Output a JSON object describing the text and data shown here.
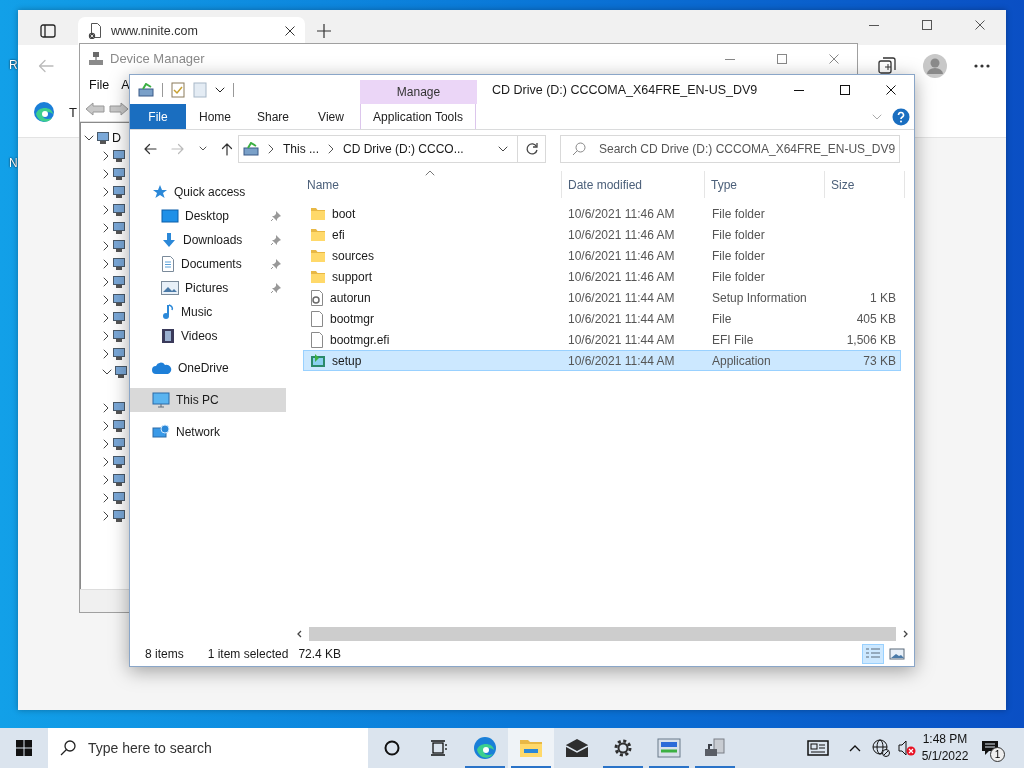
{
  "desktop": {
    "icon_labels": [
      "R",
      "N"
    ]
  },
  "browser": {
    "tab_title": "www.ninite.com",
    "toolbar_text": "T"
  },
  "device_manager": {
    "title": "Device Manager",
    "menu": [
      "File",
      "A"
    ],
    "tree": [
      {
        "label": "D",
        "expanded": true,
        "children": [
          {
            "expanded": false
          },
          {
            "expanded": false
          },
          {
            "expanded": false
          },
          {
            "expanded": false
          },
          {
            "expanded": false
          },
          {
            "expanded": false
          },
          {
            "expanded": false
          },
          {
            "expanded": false
          },
          {
            "expanded": false
          },
          {
            "expanded": false
          },
          {
            "expanded": false
          },
          {
            "expanded": false
          },
          {
            "expanded": true
          },
          {
            "expanded": false
          },
          {
            "expanded": false
          },
          {
            "expanded": false
          },
          {
            "expanded": false
          },
          {
            "expanded": false
          },
          {
            "expanded": false
          },
          {
            "expanded": false
          }
        ]
      }
    ]
  },
  "explorer": {
    "title": "CD Drive (D:) CCCOMA_X64FRE_EN-US_DV9",
    "ribbon": {
      "context_header": "Manage",
      "tabs": [
        {
          "label": "File",
          "kind": "file",
          "selected": true
        },
        {
          "label": "Home",
          "kind": "plain",
          "selected": false
        },
        {
          "label": "Share",
          "kind": "plain",
          "selected": false
        },
        {
          "label": "View",
          "kind": "plain",
          "selected": false
        },
        {
          "label": "Application Tools",
          "kind": "context",
          "selected": false
        }
      ]
    },
    "address": {
      "crumbs": [
        "This ...",
        "CD Drive (D:) CCCO..."
      ]
    },
    "search": {
      "placeholder": "Search CD Drive (D:) CCCOMA_X64FRE_EN-US_DV9"
    },
    "nav": [
      {
        "label": "Quick access",
        "kind": "quick",
        "selected": false,
        "children": [
          {
            "label": "Desktop",
            "kind": "desktop",
            "pinned": true,
            "selected": false
          },
          {
            "label": "Downloads",
            "kind": "downloads",
            "pinned": true,
            "selected": false
          },
          {
            "label": "Documents",
            "kind": "documents",
            "pinned": true,
            "selected": false
          },
          {
            "label": "Pictures",
            "kind": "pictures",
            "pinned": true,
            "selected": false
          },
          {
            "label": "Music",
            "kind": "music",
            "pinned": false,
            "selected": false
          },
          {
            "label": "Videos",
            "kind": "videos",
            "pinned": false,
            "selected": false
          }
        ]
      },
      {
        "label": "OneDrive",
        "kind": "cloud",
        "selected": false
      },
      {
        "label": "This PC",
        "kind": "pc",
        "selected": true
      },
      {
        "label": "Network",
        "kind": "network",
        "selected": false
      }
    ],
    "columns": [
      {
        "label": "Name",
        "sorted": true
      },
      {
        "label": "Date modified",
        "sorted": false
      },
      {
        "label": "Type",
        "sorted": false
      },
      {
        "label": "Size",
        "sorted": false
      }
    ],
    "files": [
      {
        "name": "boot",
        "modified": "10/6/2021 11:46 AM",
        "type": "File folder",
        "kind": "folder",
        "selected": false
      },
      {
        "name": "efi",
        "modified": "10/6/2021 11:46 AM",
        "type": "File folder",
        "kind": "folder",
        "selected": false
      },
      {
        "name": "sources",
        "modified": "10/6/2021 11:46 AM",
        "type": "File folder",
        "kind": "folder",
        "selected": false
      },
      {
        "name": "support",
        "modified": "10/6/2021 11:46 AM",
        "type": "File folder",
        "kind": "folder",
        "selected": false
      },
      {
        "name": "autorun",
        "modified": "10/6/2021 11:44 AM",
        "type": "Setup Information",
        "size": "1 KB",
        "kind": "settings",
        "selected": false
      },
      {
        "name": "bootmgr",
        "modified": "10/6/2021 11:44 AM",
        "type": "File",
        "size": "405 KB",
        "kind": "file",
        "selected": false
      },
      {
        "name": "bootmgr.efi",
        "modified": "10/6/2021 11:44 AM",
        "type": "EFI File",
        "size": "1,506 KB",
        "kind": "file",
        "selected": false
      },
      {
        "name": "setup",
        "modified": "10/6/2021 11:44 AM",
        "type": "Application",
        "size": "73 KB",
        "kind": "app",
        "selected": true
      }
    ],
    "status": {
      "count": "8 items",
      "selection": "1 item selected",
      "size": "72.4 KB"
    },
    "view_buttons": [
      {
        "kind": "details",
        "selected": true
      },
      {
        "kind": "tiles",
        "selected": false
      }
    ]
  },
  "taskbar": {
    "search_placeholder": "Type here to search",
    "apps": [
      {
        "kind": "edge",
        "running": true,
        "selected": false
      },
      {
        "kind": "explorer",
        "running": true,
        "selected": true
      },
      {
        "kind": "mail",
        "running": false,
        "selected": false
      },
      {
        "kind": "settings",
        "running": true,
        "selected": false
      },
      {
        "kind": "control",
        "running": true,
        "selected": false
      },
      {
        "kind": "devices",
        "running": true,
        "selected": false
      }
    ],
    "time": "1:48 PM",
    "date": "5/1/2022",
    "notification_count": "1"
  }
}
